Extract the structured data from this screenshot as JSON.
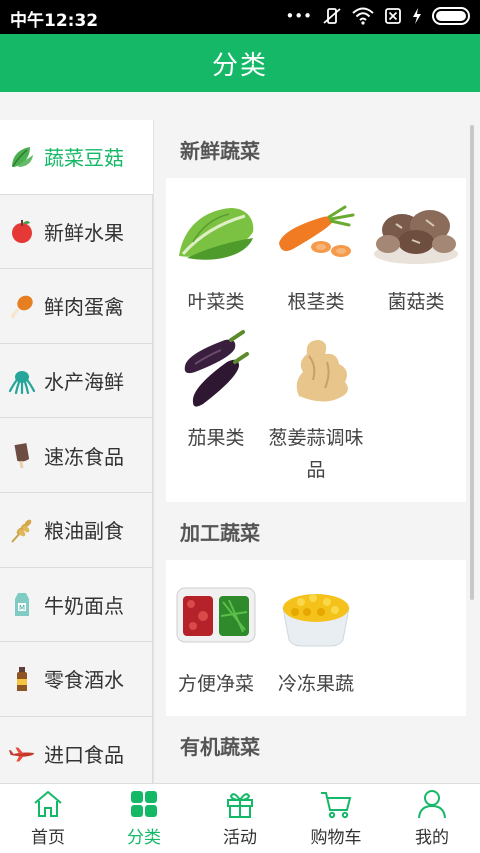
{
  "status": {
    "time": "中午12:32",
    "dots": "•••"
  },
  "header": {
    "title": "分类"
  },
  "sidebar": {
    "items": [
      {
        "label": "蔬菜豆菇",
        "icon": "leafy-vegetable-icon",
        "color": "#4caf50"
      },
      {
        "label": "新鲜水果",
        "icon": "apple-icon",
        "color": "#e53935"
      },
      {
        "label": "鲜肉蛋禽",
        "icon": "chicken-leg-icon",
        "color": "#e67e22"
      },
      {
        "label": "水产海鲜",
        "icon": "octopus-icon",
        "color": "#26a69a"
      },
      {
        "label": "速冻食品",
        "icon": "popsicle-icon",
        "color": "#6d4c41"
      },
      {
        "label": "粮油副食",
        "icon": "wheat-icon",
        "color": "#d4a84a"
      },
      {
        "label": "牛奶面点",
        "icon": "milk-carton-icon",
        "color": "#4db6ac"
      },
      {
        "label": "零食酒水",
        "icon": "bottle-icon",
        "color": "#8d5524"
      },
      {
        "label": "进口食品",
        "icon": "airplane-icon",
        "color": "#c0392b"
      }
    ]
  },
  "content": {
    "sections": [
      {
        "title": "新鲜蔬菜",
        "items": [
          {
            "name": "叶菜类",
            "icon": "lettuce-icon"
          },
          {
            "name": "根茎类",
            "icon": "carrot-icon"
          },
          {
            "name": "菌菇类",
            "icon": "mushroom-icon"
          },
          {
            "name": "茄果类",
            "icon": "eggplant-icon"
          },
          {
            "name": "葱姜蒜调味品",
            "icon": "ginger-icon"
          }
        ]
      },
      {
        "title": "加工蔬菜",
        "items": [
          {
            "name": "方便净菜",
            "icon": "prepared-vegetables-icon"
          },
          {
            "name": "冷冻果蔬",
            "icon": "frozen-corn-icon"
          }
        ]
      },
      {
        "title": "有机蔬菜",
        "items": []
      }
    ]
  },
  "tabbar": {
    "tabs": [
      {
        "label": "首页",
        "icon": "home-icon"
      },
      {
        "label": "分类",
        "icon": "category-grid-icon"
      },
      {
        "label": "活动",
        "icon": "gift-icon"
      },
      {
        "label": "购物车",
        "icon": "cart-icon"
      },
      {
        "label": "我的",
        "icon": "user-icon"
      }
    ]
  },
  "colors": {
    "brand": "#15b867",
    "background": "#f4f4f4"
  }
}
